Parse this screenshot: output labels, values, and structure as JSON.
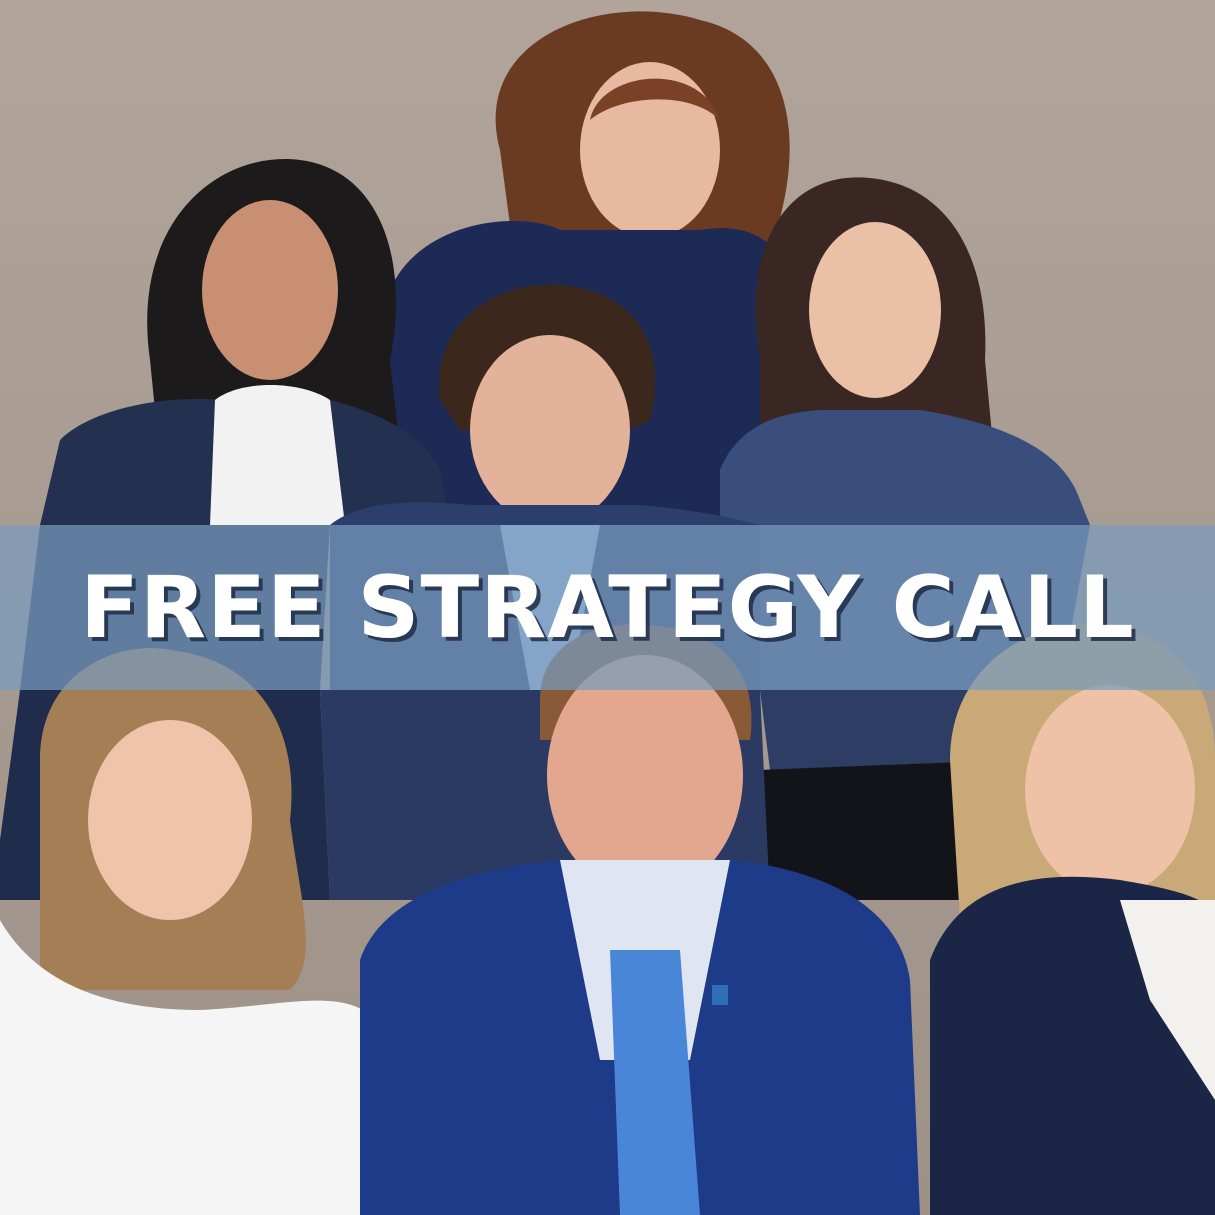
{
  "banner": {
    "text": "FREE STRATEGY CALL"
  },
  "photo": {
    "subject": "group-portrait",
    "colors": {
      "backdrop": "#aa9e94",
      "navy": "#1f2f55",
      "banner": "#789bbe",
      "text": "#ffffff"
    }
  }
}
